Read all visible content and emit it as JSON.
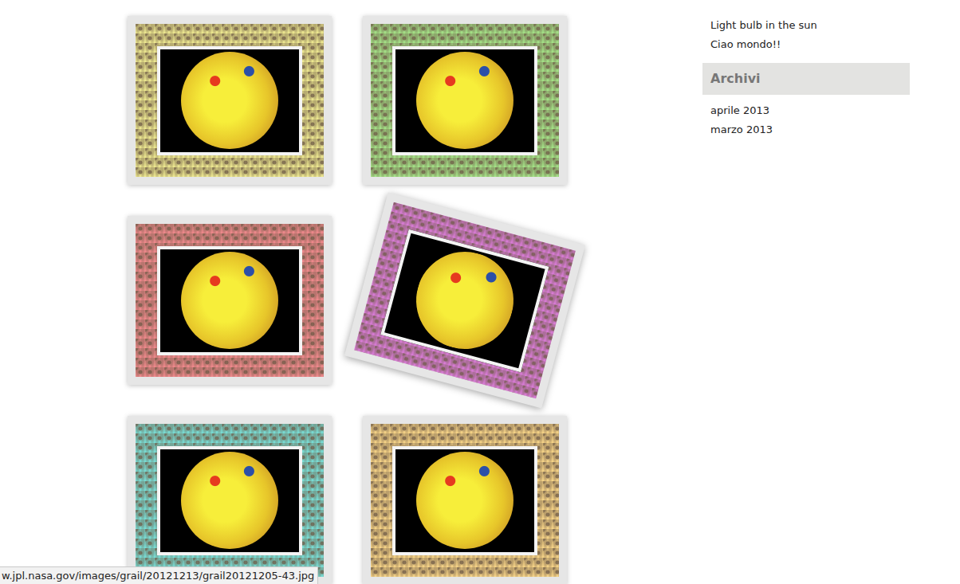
{
  "gallery": [
    {
      "color": "#f3ef94",
      "hovered": false
    },
    {
      "color": "#a6e88a",
      "hovered": false
    },
    {
      "color": "#f58b8f",
      "hovered": false
    },
    {
      "color": "#e07ee0",
      "hovered": true
    },
    {
      "color": "#79e3db",
      "hovered": false
    },
    {
      "color": "#fcd98a",
      "hovered": false
    }
  ],
  "sidebar": {
    "recent_posts": [
      "Light bulb in the sun",
      "Ciao mondo!!"
    ],
    "archives_title": "Archivi",
    "archives": [
      "aprile 2013",
      "marzo 2013"
    ]
  },
  "status_bar": "w.jpl.nasa.gov/images/grail/20121213/grail20121205-43.jpg"
}
